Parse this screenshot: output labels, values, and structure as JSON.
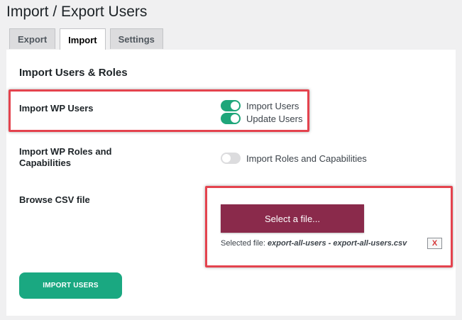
{
  "page": {
    "title": "Import / Export Users"
  },
  "tabs": [
    {
      "label": "Export",
      "active": false
    },
    {
      "label": "Import",
      "active": true
    },
    {
      "label": "Settings",
      "active": false
    }
  ],
  "section": {
    "title": "Import Users & Roles"
  },
  "import_wp_users": {
    "label": "Import WP Users",
    "toggles": [
      {
        "label": "Import Users",
        "on": true
      },
      {
        "label": "Update Users",
        "on": true
      }
    ]
  },
  "import_roles": {
    "label_line1": "Import WP Roles and",
    "label_line2": "Capabilities",
    "toggle": {
      "label": "Import Roles and Capabilities",
      "on": false
    }
  },
  "csv": {
    "label": "Browse CSV file",
    "select_button": "Select a file...",
    "selected_prefix": "Selected file:",
    "selected_name": "export-all-users - export-all-users.csv",
    "remove_label": "X"
  },
  "submit": {
    "label": "IMPORT USERS"
  },
  "colors": {
    "toggle_on": "#1fa67a",
    "toggle_off": "#dcdcde",
    "select_button": "#8a2a4b",
    "import_button": "#1aa881",
    "highlight": "#e4434e",
    "remove_x": "#d63638"
  },
  "icons": {
    "remove": "close-icon"
  }
}
